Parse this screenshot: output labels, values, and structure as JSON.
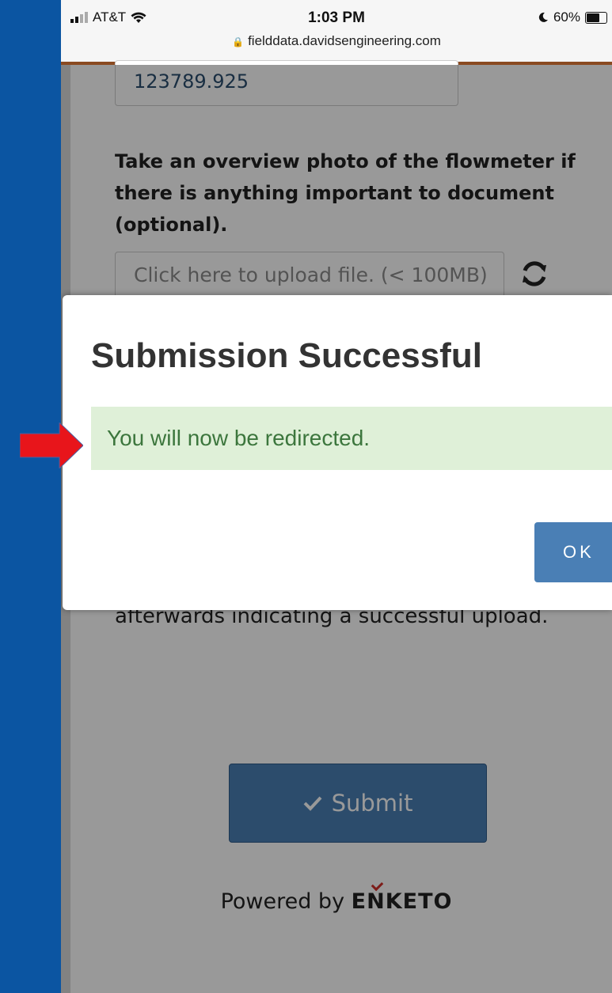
{
  "status_bar": {
    "carrier": "AT&T",
    "time": "1:03 PM",
    "battery": "60%",
    "url": "fielddata.davidsengineering.com"
  },
  "form": {
    "previous_value": "123789.925",
    "question": "Take an overview photo of the flowmeter if there is anything important to document (optional).",
    "upload_placeholder": "Click here to upload file. (< 100MB)",
    "after_text": "afterwards indicating a successful upload.",
    "submit_label": "Submit",
    "powered_by": "Powered by",
    "brand": "ENKETO"
  },
  "modal": {
    "title": "Submission Successful",
    "message": "You will now be redirected.",
    "ok_label": "OK"
  },
  "colors": {
    "background": "#0b55a2",
    "primary_button": "#4a7fb5",
    "success_bg": "#dff0d8",
    "success_text": "#3c763d",
    "annotation_arrow": "#e8151b"
  }
}
